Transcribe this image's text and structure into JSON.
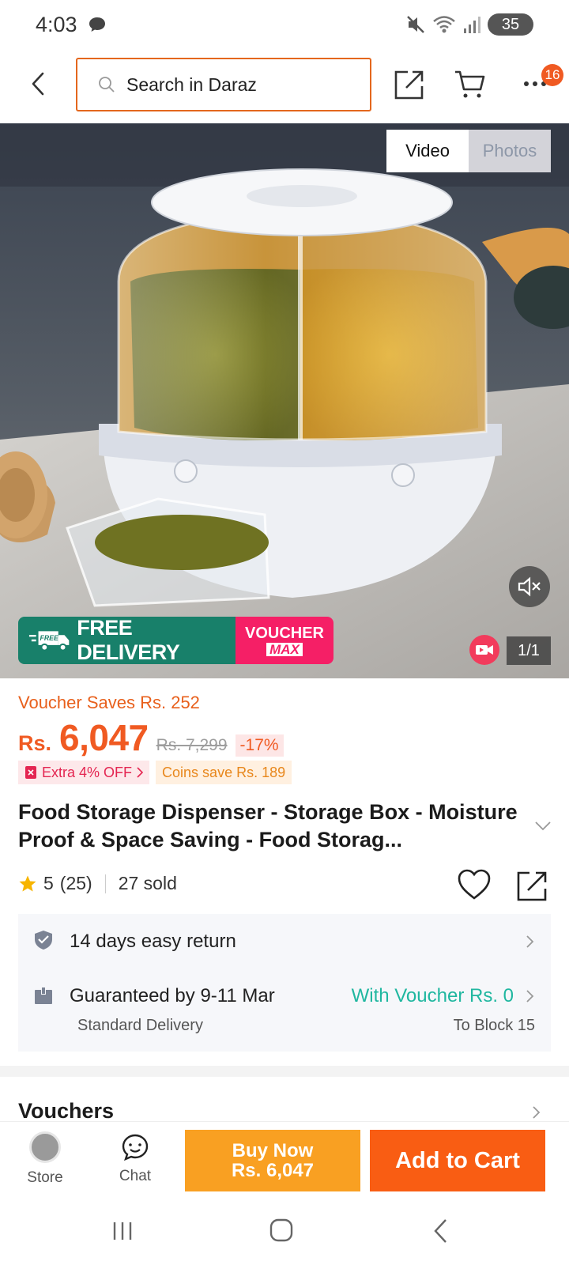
{
  "status_bar": {
    "time": "4:03",
    "battery": "35",
    "icons": [
      "chat-bubble-icon",
      "mute-icon",
      "wifi-icon",
      "signal-icon",
      "battery-icon"
    ]
  },
  "header": {
    "search_placeholder": "Search in Daraz",
    "cart_count": "16",
    "icons": [
      "back-arrow-icon",
      "search-icon",
      "share-icon",
      "cart-icon",
      "more-icon"
    ]
  },
  "media": {
    "tabs": [
      {
        "label": "Video",
        "active": true
      },
      {
        "label": "Photos",
        "active": false
      }
    ],
    "page_indicator": "1/1",
    "promo": {
      "free_icon_text": "FREE",
      "free_label": "FREE DELIVERY",
      "voucher_line1": "VOUCHER",
      "voucher_line2": "MAX"
    }
  },
  "price": {
    "voucher_saves": "Voucher Saves Rs. 252",
    "currency": "Rs.",
    "current": "6,047",
    "original": "Rs. 7,299",
    "discount": "-17%",
    "extra_off": "Extra 4% OFF",
    "coins_save": "Coins save Rs. 189"
  },
  "product": {
    "title": "Food Storage Dispenser - Storage Box - Moisture Proof & Space Saving - Food Storag...",
    "rating": "5",
    "reviews": "(25)",
    "sold": "27 sold"
  },
  "info": {
    "returns": "14 days easy return",
    "delivery_guarantee": "Guaranteed by 9-11 Mar",
    "delivery_type": "Standard Delivery",
    "voucher_fee": "With Voucher Rs. 0",
    "location": "To Block 15"
  },
  "vouchers": {
    "title": "Vouchers"
  },
  "bottom_bar": {
    "store_label": "Store",
    "chat_label": "Chat",
    "buy_now_line1": "Buy Now",
    "buy_now_line2": "Rs. 6,047",
    "add_to_cart": "Add to Cart"
  },
  "colors": {
    "brand_orange": "#f95d13",
    "buy_now_orange": "#f9a022",
    "price_orange": "#f05a22",
    "teal": "#20b7a0",
    "free_delivery_green": "#18806a",
    "voucher_pink": "#f51f66"
  }
}
